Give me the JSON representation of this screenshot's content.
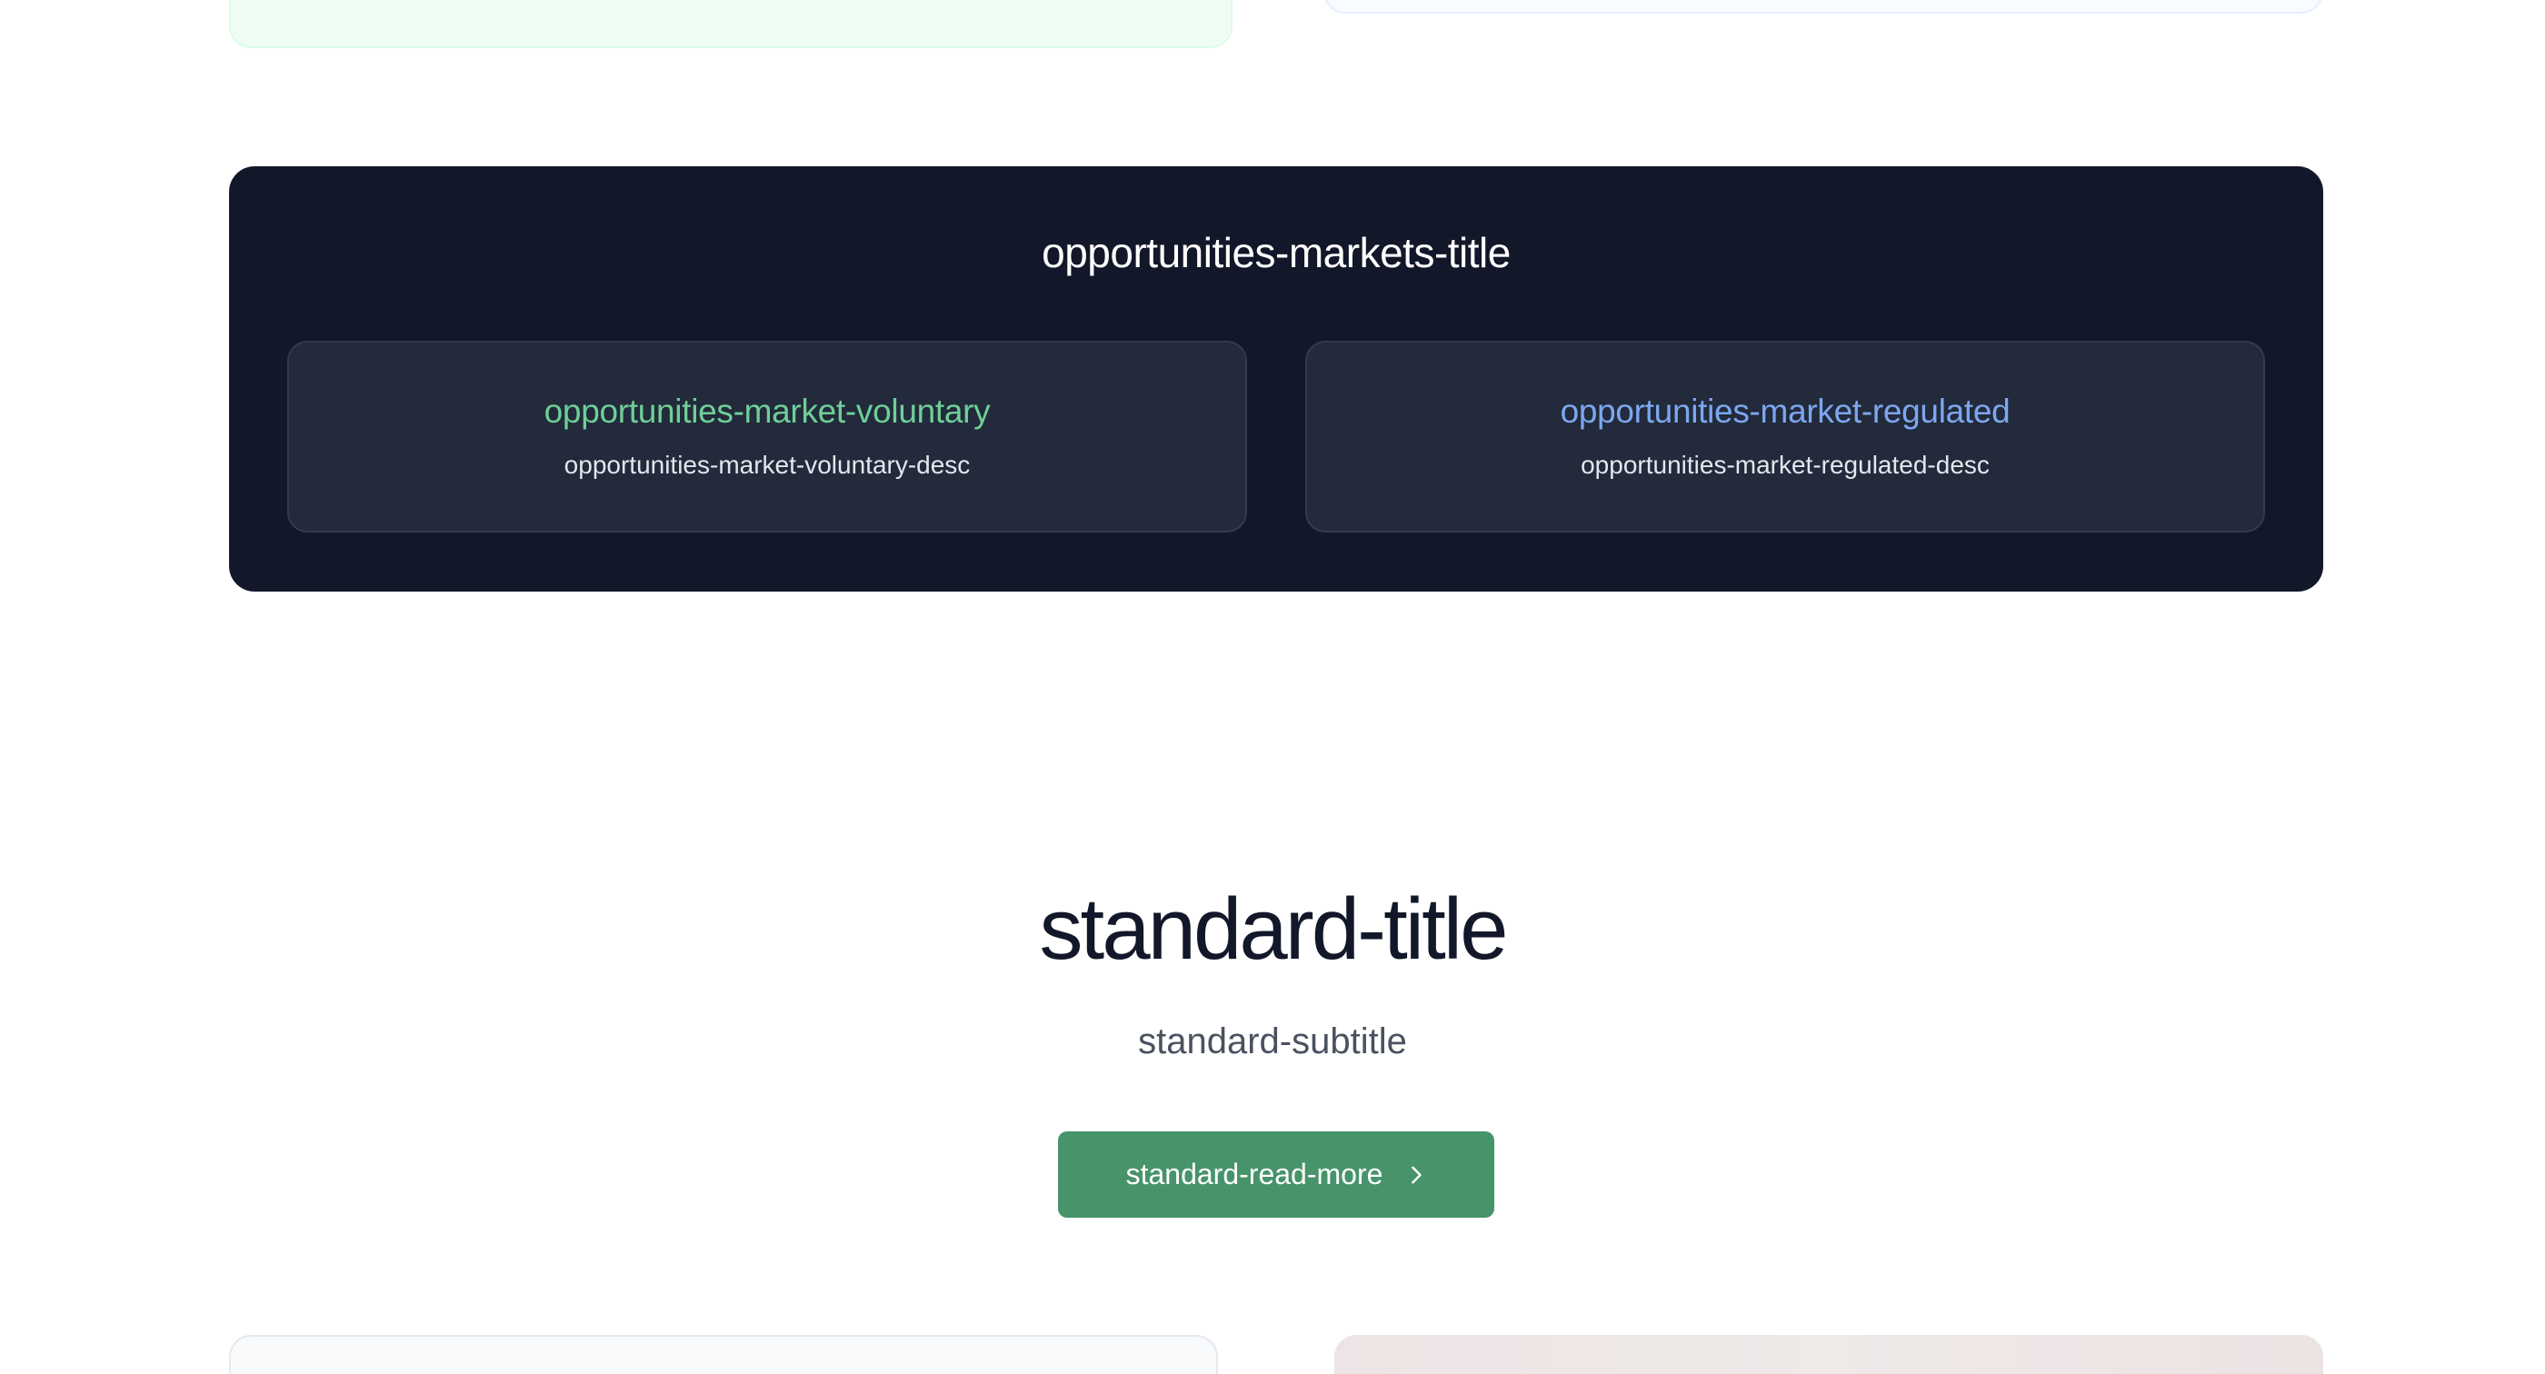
{
  "markets": {
    "title": "opportunities-markets-title",
    "voluntary": {
      "name": "opportunities-market-voluntary",
      "desc": "opportunities-market-voluntary-desc",
      "color": "#6fcf97"
    },
    "regulated": {
      "name": "opportunities-market-regulated",
      "desc": "opportunities-market-regulated-desc",
      "color": "#7da7ef"
    }
  },
  "standard": {
    "title": "standard-title",
    "subtitle": "standard-subtitle",
    "read_more_label": "standard-read-more",
    "read_more_icon": "chevron-right-icon"
  },
  "colors": {
    "panel_bg": "#121829",
    "card_bg": "#222a3b",
    "button_bg": "#47946a"
  }
}
